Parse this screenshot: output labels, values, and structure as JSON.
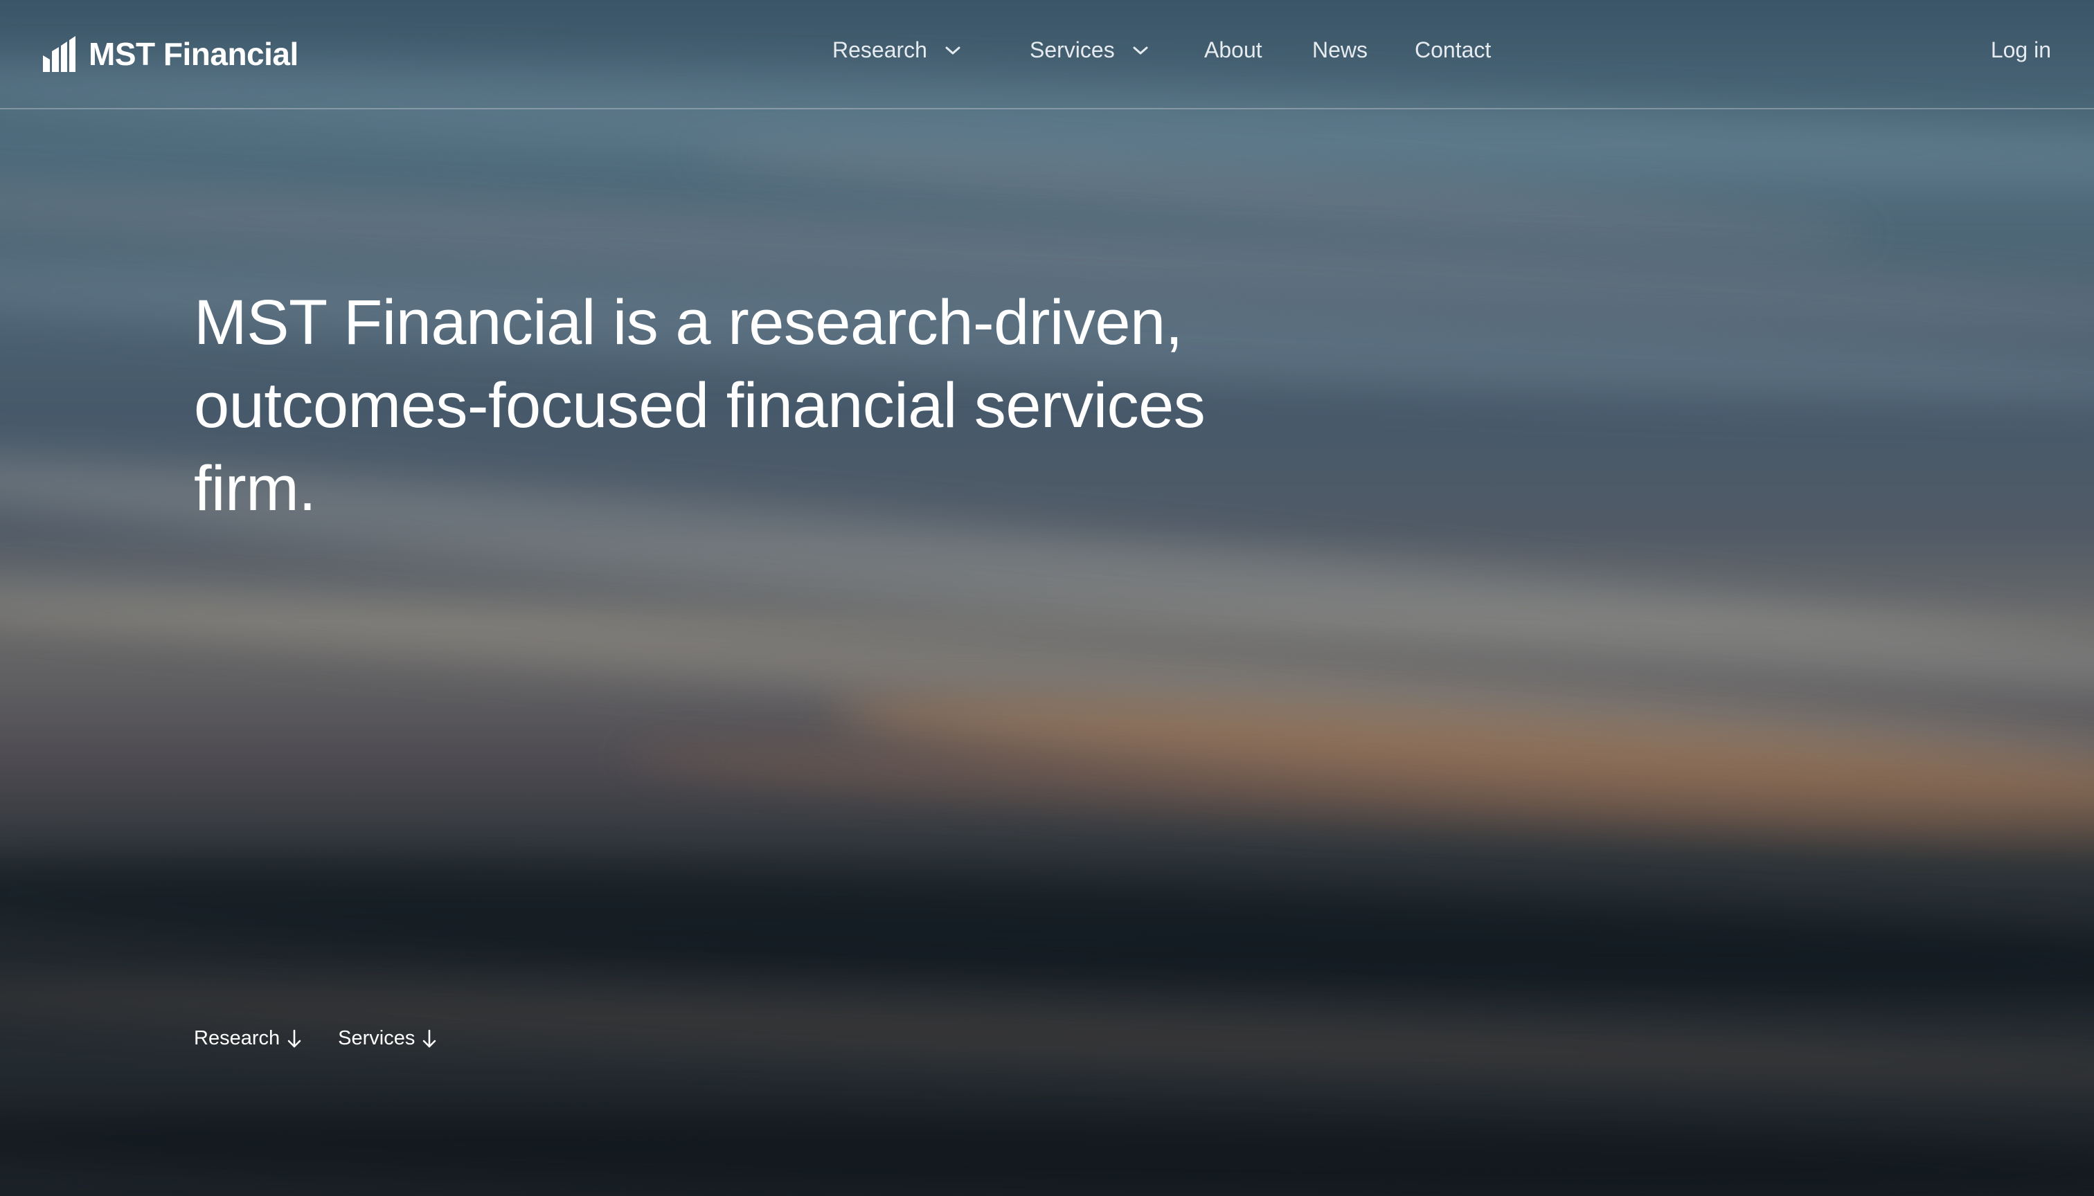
{
  "brand": {
    "name": "MST Financial",
    "logo_icon": "bar-chart-logo-icon"
  },
  "nav": {
    "items": [
      {
        "label": "Research",
        "has_dropdown": true
      },
      {
        "label": "Services",
        "has_dropdown": true
      },
      {
        "label": "About",
        "has_dropdown": false
      },
      {
        "label": "News",
        "has_dropdown": false
      },
      {
        "label": "Contact",
        "has_dropdown": false
      }
    ],
    "login_label": "Log in"
  },
  "hero": {
    "headline": "MST Financial is a research-driven, outcomes-focused financial services firm."
  },
  "quick_links": [
    {
      "label": "Research",
      "icon": "arrow-down-icon"
    },
    {
      "label": "Services",
      "icon": "arrow-down-icon"
    }
  ]
}
